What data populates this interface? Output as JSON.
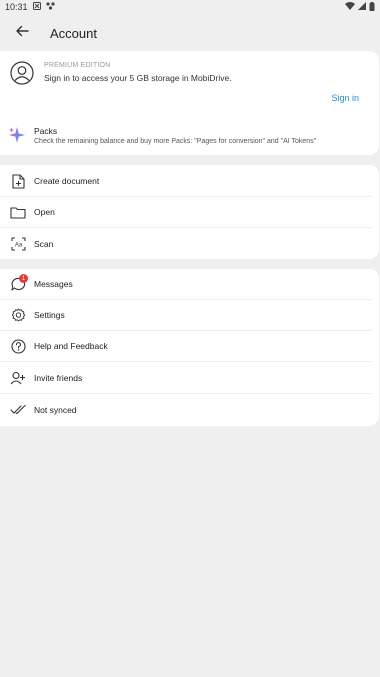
{
  "status_bar": {
    "time": "10:31"
  },
  "header": {
    "title": "Account"
  },
  "account": {
    "premium_label": "PREMIUM EDITION",
    "description": "Sign in to access your 5 GB storage in MobiDrive.",
    "sign_in_label": "Sign in"
  },
  "packs": {
    "title": "Packs",
    "description": "Check the remaining balance and buy more Packs: \"Pages for conversion\" and \"AI Tokens\""
  },
  "tools_menu": [
    {
      "label": "Create document",
      "icon": "create-document-icon"
    },
    {
      "label": "Open",
      "icon": "folder-icon"
    },
    {
      "label": "Scan",
      "icon": "scan-icon"
    }
  ],
  "more_menu": [
    {
      "label": "Messages",
      "icon": "messages-icon",
      "badge": "1"
    },
    {
      "label": "Settings",
      "icon": "gear-icon"
    },
    {
      "label": "Help and Feedback",
      "icon": "help-icon"
    },
    {
      "label": "Invite friends",
      "icon": "add-person-icon"
    },
    {
      "label": "Not synced",
      "icon": "double-check-icon"
    }
  ],
  "colors": {
    "accent": "#1a8fd8",
    "badge": "#e53935",
    "background": "#efefef",
    "card": "#ffffff"
  }
}
